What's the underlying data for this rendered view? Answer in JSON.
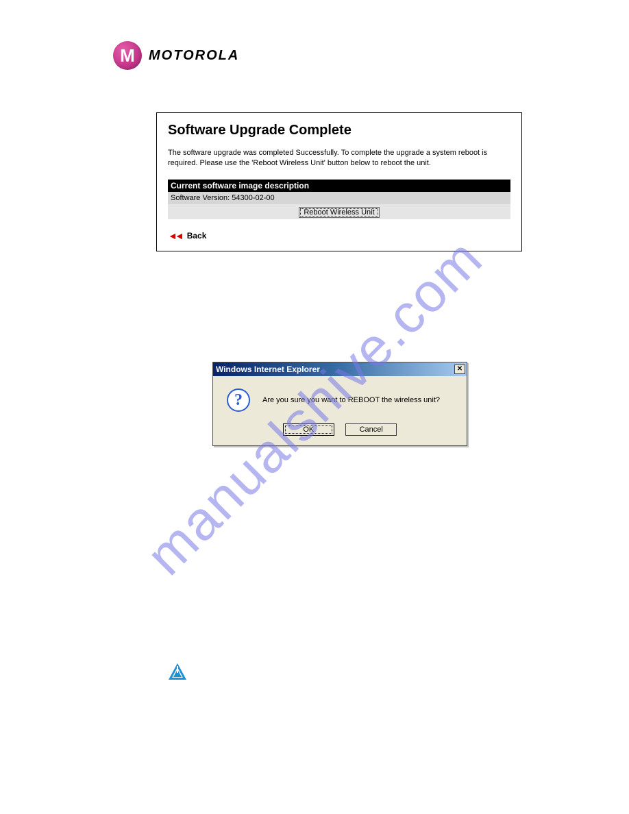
{
  "logo": {
    "glyph": "M",
    "brand": "MOTOROLA"
  },
  "upgrade_panel": {
    "title": "Software Upgrade Complete",
    "message": "The software upgrade was completed Successfully. To complete the upgrade a system reboot is required. Please use the 'Reboot Wireless Unit' button below to reboot the unit.",
    "table_header": "Current software image description",
    "version_label": "Software Version:",
    "version_value": "54300-02-00",
    "reboot_button": "Reboot Wireless Unit",
    "back_label": "Back"
  },
  "dialog": {
    "title": "Windows Internet Explorer",
    "message": "Are you sure you want to REBOOT the wireless unit?",
    "ok": "OK",
    "cancel": "Cancel"
  },
  "watermark": "manualshive.com"
}
